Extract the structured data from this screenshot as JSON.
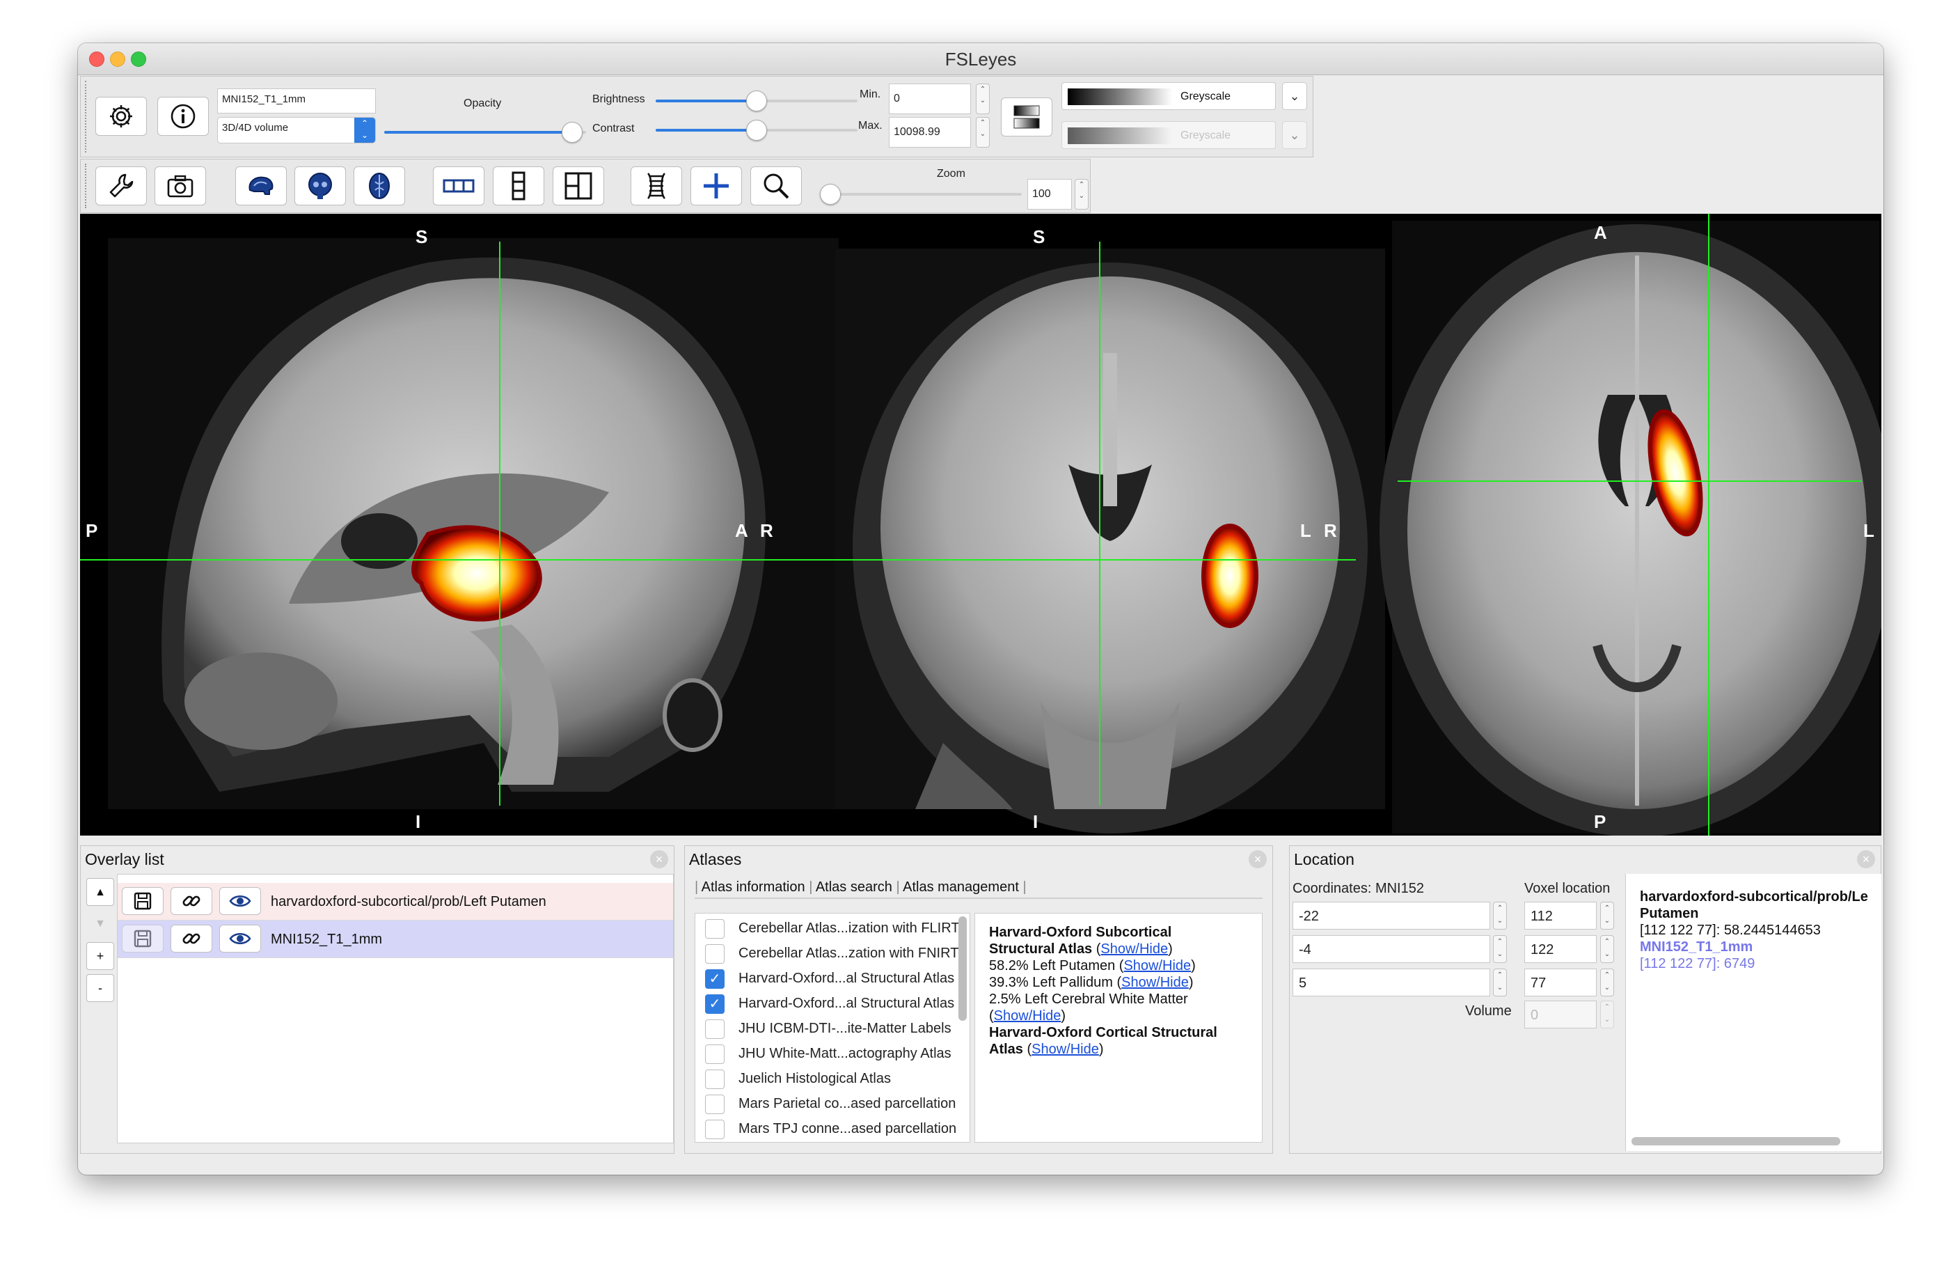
{
  "window": {
    "title": "FSLeyes"
  },
  "overlay_toolbar": {
    "overlay_name": "MNI152_T1_1mm",
    "overlay_type": "3D/4D volume",
    "opacity_label": "Opacity",
    "opacity_level": 0.98,
    "brightness_label": "Brightness",
    "brightness_level": 0.5,
    "contrast_label": "Contrast",
    "contrast_level": 0.5,
    "min_label": "Min.",
    "min_value": "0",
    "max_label": "Max.",
    "max_value": "10098.99",
    "colormap": "Greyscale",
    "neg_colormap": "Greyscale"
  },
  "ortho_toolbar": {
    "zoom_label": "Zoom",
    "zoom_value": "100",
    "zoom_level": 0.0
  },
  "views": {
    "sagittal": {
      "top": "S",
      "bottom": "I",
      "left": "P",
      "right": "A"
    },
    "coronal": {
      "top": "S",
      "bottom": "I",
      "left": "R",
      "right": "L"
    },
    "axial": {
      "top": "A",
      "bottom": "P",
      "left": "R",
      "right": "L"
    }
  },
  "overlay_list": {
    "title": "Overlay list",
    "items": [
      {
        "name": "harvardoxford-subcortical/prob/Left Putamen"
      },
      {
        "name": "MNI152_T1_1mm"
      }
    ],
    "buttons": {
      "up": "▲",
      "down": "▼",
      "add": "+",
      "remove": "-"
    }
  },
  "atlases": {
    "title": "Atlases",
    "tabs": [
      "Atlas information",
      "Atlas search",
      "Atlas management"
    ],
    "list": [
      {
        "label": "Cerebellar Atlas...ization with FLIRT",
        "checked": false
      },
      {
        "label": "Cerebellar Atlas...zation with FNIRT",
        "checked": false
      },
      {
        "label": "Harvard-Oxford...al Structural Atlas",
        "checked": true
      },
      {
        "label": "Harvard-Oxford...al Structural Atlas",
        "checked": true
      },
      {
        "label": "JHU ICBM-DTI-...ite-Matter Labels",
        "checked": false
      },
      {
        "label": "JHU White-Matt...actography Atlas",
        "checked": false
      },
      {
        "label": "Juelich Histological Atlas",
        "checked": false
      },
      {
        "label": "Mars Parietal co...ased parcellation",
        "checked": false
      },
      {
        "label": "Mars TPJ conne...ased parcellation",
        "checked": false
      }
    ],
    "info": {
      "sub_title_1": "Harvard-Oxford Subcortical",
      "sub_title_2": "Structural Atlas",
      "show_hide": "Show/Hide",
      "line1": "58.2% Left Putamen",
      "line2": "39.3% Left Pallidum",
      "line3": "2.5% Left Cerebral White Matter",
      "cort_title_1": "Harvard-Oxford Cortical Structural",
      "cort_title_2": "Atlas"
    }
  },
  "location": {
    "title": "Location",
    "coords_label": "Coordinates: MNI152",
    "voxel_label": "Voxel location",
    "coords": [
      "-22",
      "-4",
      "5"
    ],
    "voxels": [
      "112",
      "122",
      "77"
    ],
    "volume_label": "Volume",
    "volume_value": "0",
    "info": {
      "name1": "harvardoxford-subcortical/prob/Le",
      "name1b": "Putamen",
      "value1": "[112 122 77]: 58.2445144653",
      "name2": "MNI152_T1_1mm",
      "value2": "[112 122 77]: 6749"
    }
  },
  "colors": {
    "accent": "#2f7de1",
    "link": "#1a4fd8",
    "cursor": "#22ee22",
    "overlay_row": "#fbeaea",
    "selected_row": "#d6d6f8"
  }
}
